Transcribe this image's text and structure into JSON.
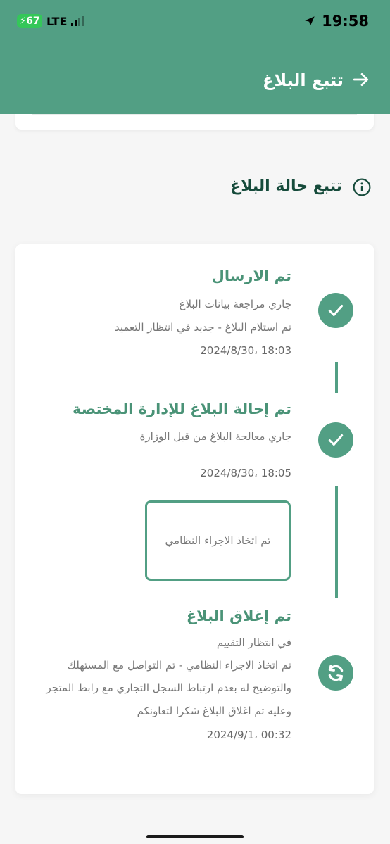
{
  "status_bar": {
    "battery": "67",
    "network": "LTE",
    "time": "19:58"
  },
  "header": {
    "title": "تتبع البلاغ",
    "back_icon": "arrow-right-icon"
  },
  "section": {
    "title": "تتبع حالة البلاغ",
    "icon": "info-icon"
  },
  "timeline": {
    "steps": [
      {
        "title": "تم الارسال",
        "lines": [
          "جاري مراجعة بيانات البلاغ",
          "تم استلام البلاغ - جديد في انتظار التعميد"
        ],
        "date": "2024/8/30، 18:03",
        "icon": "check-icon"
      },
      {
        "title": "تم إحالة البلاغ للإدارة المختصة",
        "lines": [
          "جاري معالجة البلاغ من قبل الوزارة"
        ],
        "date": "2024/8/30، 18:05",
        "action": "تم اتخاذ الاجراء النظامي",
        "icon": "check-icon"
      },
      {
        "title": "تم إغلاق البلاغ",
        "lines": [
          "في انتظار التقييم",
          "تم اتخاذ الاجراء النظامي - تم التواصل مع المستهلك",
          "والتوضيح له بعدم ارتباط السجل التجاري مع رابط المتجر",
          "وعليه تم اغلاق البلاغ شكرا لتعاونكم"
        ],
        "date": "2024/9/1، 00:32",
        "icon": "refresh-icon"
      }
    ]
  },
  "colors": {
    "primary": "#529f84",
    "title_green": "#4a9377",
    "dark_heading": "#164b3b"
  }
}
